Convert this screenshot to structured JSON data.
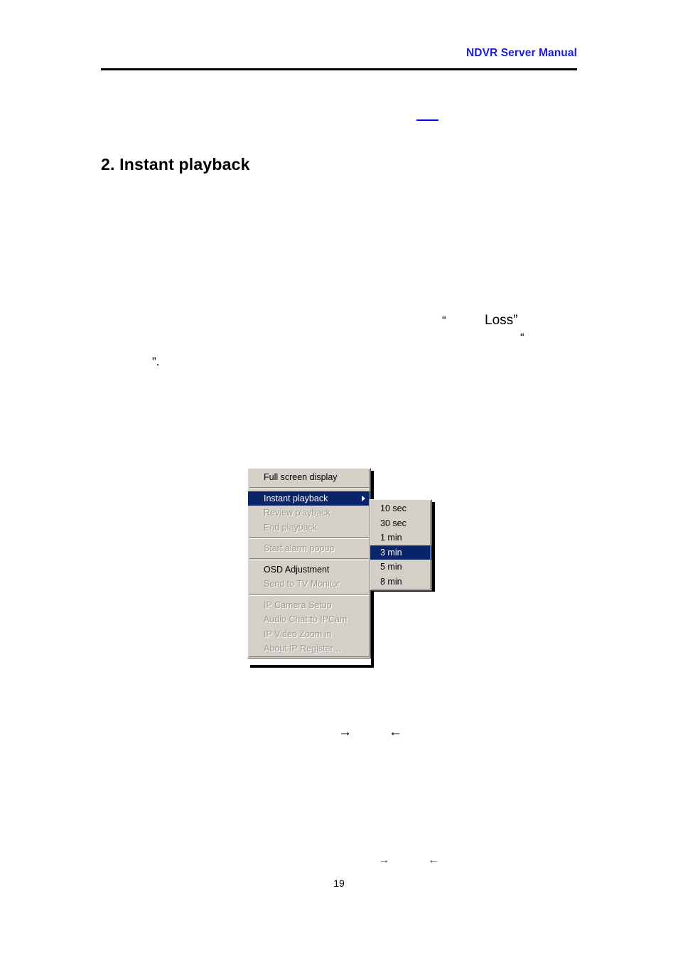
{
  "document": {
    "header_title": "NDVR Server Manual",
    "heading": "2. Instant playback",
    "page_number": "19",
    "accent_color": "#1a1ae0",
    "link_color": "#0000ee"
  },
  "body_fragments": {
    "quote_open_1": "“",
    "loss_word": "Loss”",
    "quote_open_2": "“",
    "quote_close": "”.",
    "arrow_right_1": "→",
    "arrow_left_1": "←",
    "arrow_right_2": "→",
    "arrow_left_2": "←"
  },
  "context_menu": {
    "background_color": "#d4d0c8",
    "highlight_color": "#0a246a",
    "disabled_color": "#9a9a93",
    "items": [
      {
        "label": "Full screen display",
        "state": "enabled"
      },
      {
        "label": "Instant playback",
        "state": "selected",
        "has_submenu": true
      },
      {
        "label": "Review playback",
        "state": "disabled"
      },
      {
        "label": "End playback",
        "state": "disabled"
      },
      {
        "label": "Start alarm popup",
        "state": "disabled"
      },
      {
        "label": "OSD Adjustment",
        "state": "enabled"
      },
      {
        "label": "Send to TV Monitor",
        "state": "disabled"
      },
      {
        "label": "IP Camera Setup",
        "state": "disabled"
      },
      {
        "label": "Audio Chat to IPCam",
        "state": "disabled"
      },
      {
        "label": "IP Video Zoom in",
        "state": "disabled"
      },
      {
        "label": "About IP Register…",
        "state": "disabled"
      }
    ],
    "submenu": {
      "parent": "Instant playback",
      "items": [
        {
          "label": "10 sec",
          "state": "enabled"
        },
        {
          "label": "30 sec",
          "state": "enabled"
        },
        {
          "label": "1 min",
          "state": "enabled"
        },
        {
          "label": "3 min",
          "state": "selected"
        },
        {
          "label": "5 min",
          "state": "enabled"
        },
        {
          "label": "8 min",
          "state": "enabled"
        }
      ]
    }
  }
}
